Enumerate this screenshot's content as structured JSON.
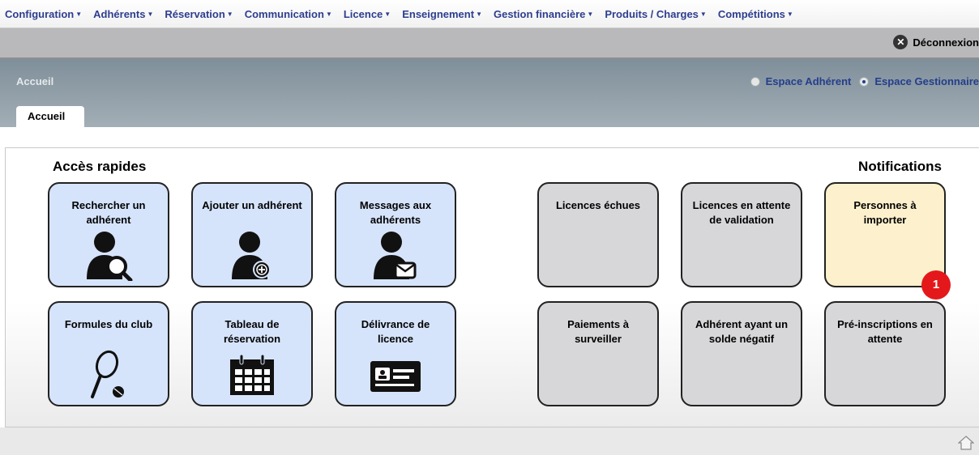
{
  "menu": {
    "items": [
      {
        "label": "Configuration"
      },
      {
        "label": "Adhérents"
      },
      {
        "label": "Réservation"
      },
      {
        "label": "Communication"
      },
      {
        "label": "Licence"
      },
      {
        "label": "Enseignement"
      },
      {
        "label": "Gestion financière"
      },
      {
        "label": "Produits / Charges"
      },
      {
        "label": "Compétitions"
      }
    ]
  },
  "header": {
    "logout_label": "Déconnexion",
    "breadcrumb": "Accueil",
    "espace_adherent": "Espace Adhérent",
    "espace_gestionnaire": "Espace Gestionnaire",
    "selected_espace": "Espace Gestionnaire",
    "tab_label": "Accueil"
  },
  "quick_access": {
    "title": "Accès rapides",
    "tiles": [
      {
        "label": "Rechercher un adhérent",
        "icon": "user-search-icon"
      },
      {
        "label": "Ajouter un adhérent",
        "icon": "user-add-icon"
      },
      {
        "label": "Messages aux adhérents",
        "icon": "user-mail-icon"
      },
      {
        "label": "Formules du club",
        "icon": "tennis-racket-icon"
      },
      {
        "label": "Tableau de réservation",
        "icon": "calendar-icon"
      },
      {
        "label": "Délivrance de licence",
        "icon": "license-card-icon"
      }
    ]
  },
  "notifications": {
    "title": "Notifications",
    "tiles": [
      {
        "label": "Licences échues"
      },
      {
        "label": "Licences en attente de validation"
      },
      {
        "label": "Personnes à importer",
        "badge": "1"
      },
      {
        "label": "Paiements à surveiller"
      },
      {
        "label": "Adhérent ayant un solde négatif"
      },
      {
        "label": "Pré-inscriptions en attente"
      }
    ]
  },
  "colors": {
    "menu_text": "#2d3e8f",
    "tile_blue": "#d6e4fb",
    "tile_grey": "#d7d7da",
    "tile_yellow": "#fdf1cd",
    "badge": "#e4181b"
  }
}
